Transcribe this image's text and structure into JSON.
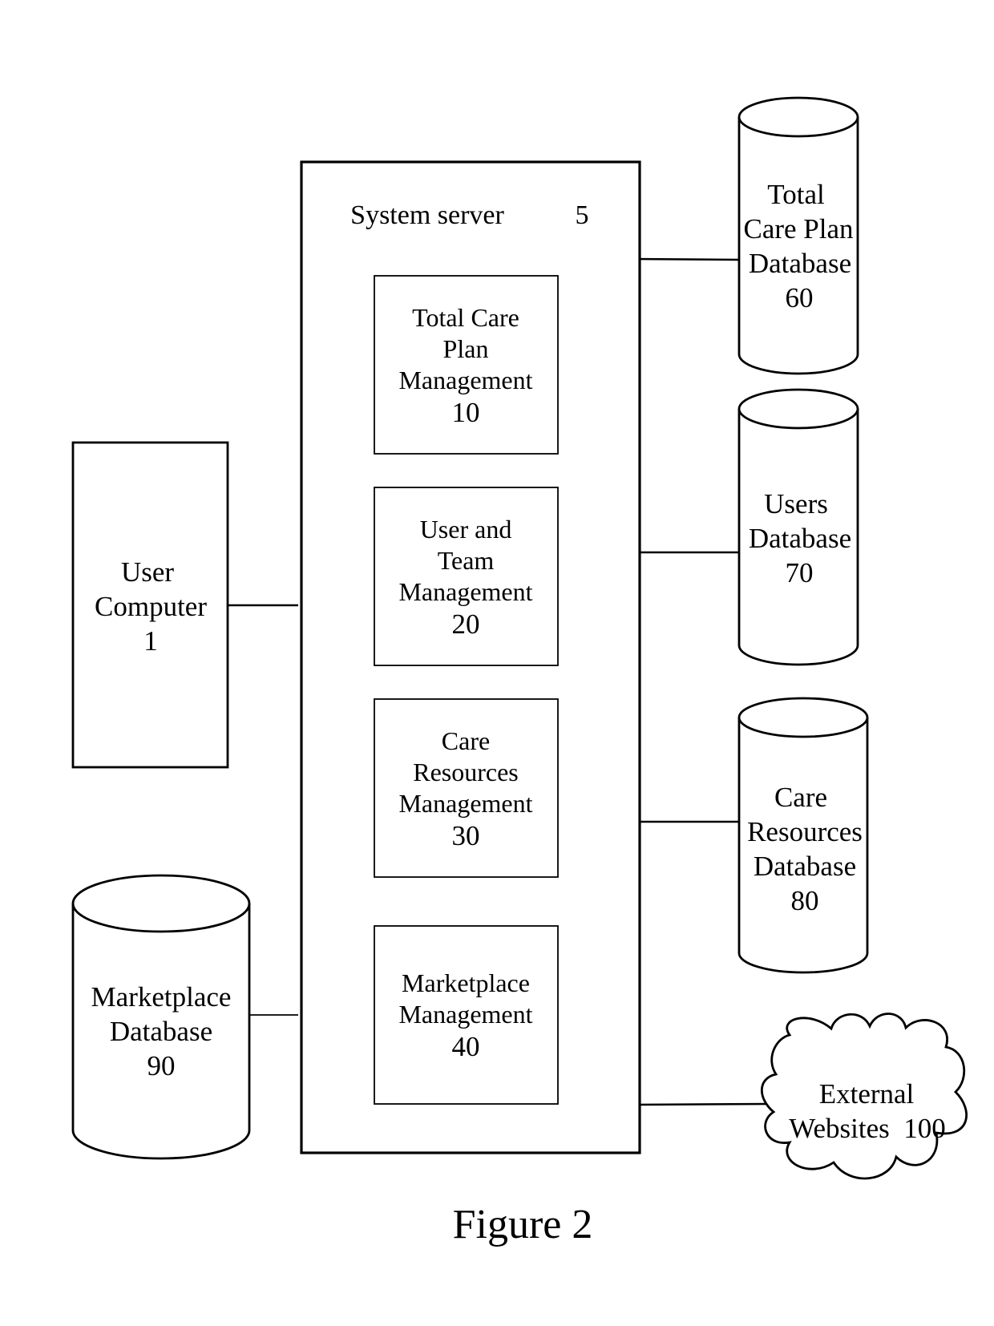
{
  "figure": {
    "caption": "Figure 2",
    "colors": {
      "stroke": "#000000",
      "background": "#ffffff"
    }
  },
  "server": {
    "title": "System server",
    "ref": "5",
    "modules": [
      {
        "lines": [
          "Total Care",
          "Plan",
          "Management",
          "10"
        ]
      },
      {
        "lines": [
          "User and",
          "Team",
          "Management",
          "20"
        ]
      },
      {
        "lines": [
          "Care",
          "Resources",
          "Management",
          "30"
        ]
      },
      {
        "lines": [
          "Marketplace",
          "Management",
          "40"
        ]
      }
    ]
  },
  "user_computer": {
    "lines": [
      "User",
      "Computer",
      "1"
    ]
  },
  "databases": {
    "total_care_plan": {
      "lines": [
        "Total",
        "Care Plan",
        "Database",
        "60"
      ]
    },
    "users": {
      "lines": [
        "Users",
        "Database",
        "70"
      ]
    },
    "care_resources": {
      "lines": [
        "Care",
        "Resources",
        "Database",
        "80"
      ]
    },
    "marketplace": {
      "lines": [
        "Marketplace",
        "Database",
        "90"
      ]
    }
  },
  "external": {
    "lines": [
      "External",
      "Websites  100"
    ]
  },
  "connections": [
    {
      "from": "User Computer 1",
      "to": "System server 5"
    },
    {
      "from": "Marketplace Database 90",
      "to": "System server 5"
    },
    {
      "from": "System server 5",
      "to": "Total Care Plan Database 60"
    },
    {
      "from": "System server 5",
      "to": "Users Database 70"
    },
    {
      "from": "System server 5",
      "to": "Care Resources Database 80"
    },
    {
      "from": "System server 5",
      "to": "External Websites 100"
    }
  ]
}
